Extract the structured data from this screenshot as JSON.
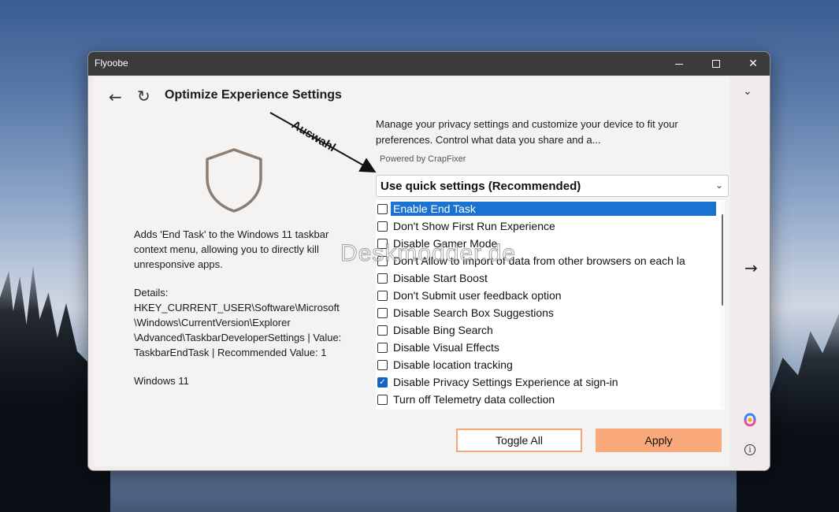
{
  "window": {
    "app_title": "Flyoobe"
  },
  "header": {
    "page_title": "Optimize Experience Settings"
  },
  "left_panel": {
    "description": "Adds 'End Task' to the Windows 11 taskbar context menu, allowing you to directly kill unresponsive apps.",
    "details": "Details:\nHKEY_CURRENT_USER\\Software\\Microsoft\n\\Windows\\CurrentVersion\\Explorer\n\\Advanced\\TaskbarDeveloperSettings | Value:\nTaskbarEndTask | Recommended Value: 1",
    "os_label": "Windows 11"
  },
  "right_panel": {
    "intro": "Manage your privacy settings and customize your device to fit your preferences. Control what data you share and a...",
    "powered_by": "Powered by CrapFixer",
    "dropdown_value": "Use quick settings (Recommended)"
  },
  "options": [
    {
      "label": "Enable End Task",
      "checked": false,
      "selected": true
    },
    {
      "label": "Don't Show First Run Experience",
      "checked": false,
      "selected": false
    },
    {
      "label": "Disable Gamer Mode",
      "checked": false,
      "selected": false
    },
    {
      "label": "Don't Allow to import of data from other browsers on each la",
      "checked": false,
      "selected": false
    },
    {
      "label": "Disable Start Boost",
      "checked": false,
      "selected": false
    },
    {
      "label": "Don't Submit user feedback option",
      "checked": false,
      "selected": false
    },
    {
      "label": "Disable Search Box Suggestions",
      "checked": false,
      "selected": false
    },
    {
      "label": "Disable Bing Search",
      "checked": false,
      "selected": false
    },
    {
      "label": "Disable Visual Effects",
      "checked": false,
      "selected": false
    },
    {
      "label": "Disable location tracking",
      "checked": false,
      "selected": false
    },
    {
      "label": "Disable Privacy Settings Experience at sign-in",
      "checked": true,
      "selected": false
    },
    {
      "label": "Turn off Telemetry data collection",
      "checked": false,
      "selected": false
    }
  ],
  "buttons": {
    "toggle_all": "Toggle All",
    "apply": "Apply"
  },
  "annotation": {
    "label": "Auswahl",
    "watermark": "Deskmodder.de"
  },
  "colors": {
    "accent_orange": "#f9a97a",
    "selection_blue": "#1a73d0",
    "titlebar": "#3b3b3b"
  }
}
